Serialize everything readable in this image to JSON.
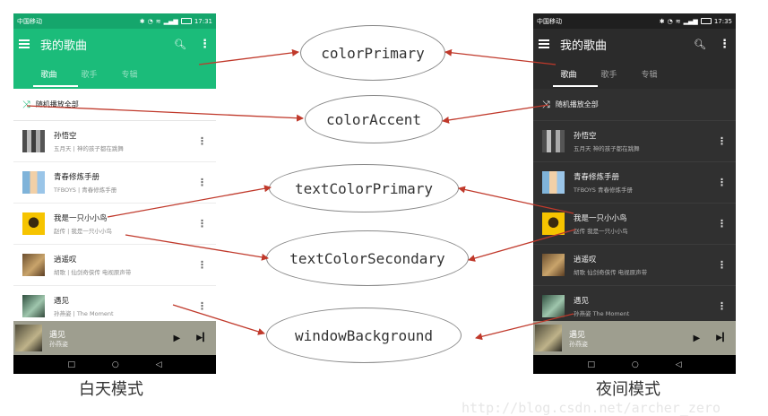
{
  "status_bar": {
    "carrier": "中国移动",
    "time_day": "17:31",
    "time_night": "17:35",
    "status_icons": [
      "bluetooth-icon",
      "alarm-icon",
      "wifi-icon",
      "signal-icon",
      "battery-icon"
    ]
  },
  "appbar": {
    "title": "我的歌曲"
  },
  "tabs": [
    "歌曲",
    "歌手",
    "专辑"
  ],
  "shuffle_label": "随机播放全部",
  "songs": [
    {
      "title": "孙悟空",
      "artist": "五月天",
      "album": "神的孩子都在跳舞"
    },
    {
      "title": "青春修炼手册",
      "artist": "TFBOYS",
      "album": "青春修炼手册"
    },
    {
      "title": "我是一只小小鸟",
      "artist": "赵传",
      "album": "我是一只小小鸟"
    },
    {
      "title": "逍遥叹",
      "artist": "胡歌",
      "album": "仙剑奇侠传 电视原声带"
    },
    {
      "title": "遇见",
      "artist": "孙燕姿",
      "album": "The Moment"
    }
  ],
  "now_playing": {
    "title": "遇见",
    "artist": "孙燕姿"
  },
  "labels": {
    "colorPrimary": "colorPrimary",
    "colorAccent": "colorAccent",
    "textColorPrimary": "textColorPrimary",
    "textColorSecondary": "textColorSecondary",
    "windowBackground": "windowBackground"
  },
  "captions": {
    "day": "白天模式",
    "night": "夜间模式"
  },
  "watermark": "http://blog.csdn.net/archer_zero",
  "colors": {
    "day_primary": "#1bbc7a",
    "day_status": "#15a66c",
    "night_primary": "#2b2b2b",
    "night_background": "#303030",
    "arrow": "#c0392b"
  }
}
